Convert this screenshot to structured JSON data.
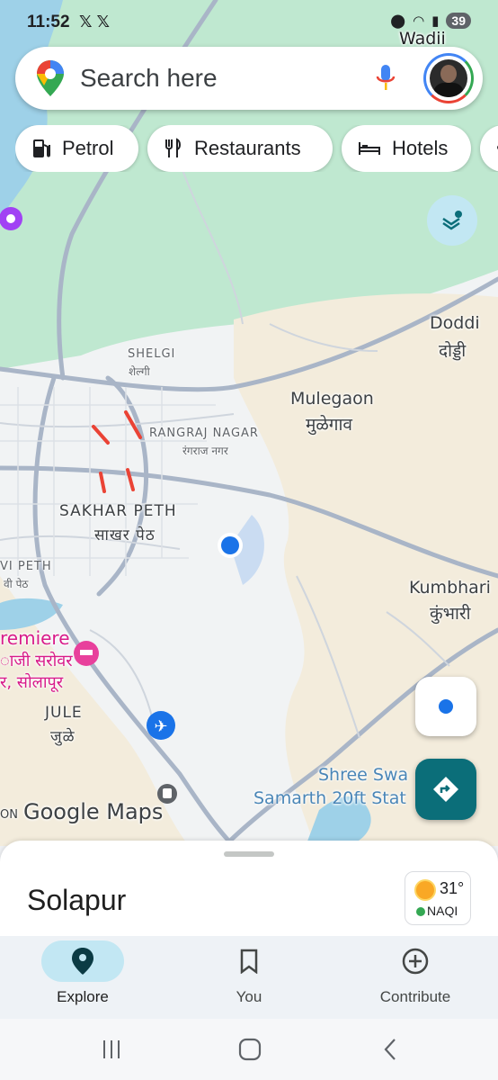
{
  "status_bar": {
    "time": "11:52",
    "notification_icons": "𝕏 𝕏",
    "battery": "39"
  },
  "search": {
    "placeholder": "Search here"
  },
  "chips": [
    {
      "label": "Petrol",
      "icon": "gas-station-icon"
    },
    {
      "label": "Restaurants",
      "icon": "fork-knife-icon"
    },
    {
      "label": "Hotels",
      "icon": "bed-icon"
    }
  ],
  "map_labels": {
    "wadii": "Wadii",
    "doddi_en": "Doddi",
    "doddi_mr": "दोड्डी",
    "shelgi_en": "SHELGI",
    "shelgi_mr": "शेल्गी",
    "mulegaon_en": "Mulegaon",
    "mulegaon_mr": "मुळेगाव",
    "rangraj_en": "RANGRAJ NAGAR",
    "rangraj_mr": "रंगराज नगर",
    "sakhar_en": "SAKHAR PETH",
    "sakhar_mr": "साखर पेठ",
    "vipeth_en": "VI PETH",
    "vipeth_mr": "वी पेठ",
    "kumbhari_en": "Kumbhari",
    "kumbhari_mr": "कुंभारी",
    "premiere": "remiere",
    "sarovar_1": "ाजी सरोवर",
    "sarovar_2": "र, सोलापूर",
    "jule_en": "JULE",
    "jule_mr": "जुळे",
    "shree_1": "Shree Swa",
    "shree_2": "Samarth 20ft Stat",
    "google_prefix": "ON",
    "google_maps": "Google Maps"
  },
  "bottom_sheet": {
    "place": "Solapur",
    "temperature": "31°",
    "aqi_label": "NAQI"
  },
  "bottom_nav": [
    {
      "label": "Explore",
      "icon": "explore-pin-icon",
      "active": true
    },
    {
      "label": "You",
      "icon": "bookmark-icon",
      "active": false
    },
    {
      "label": "Contribute",
      "icon": "add-circle-icon",
      "active": false
    }
  ],
  "colors": {
    "accent": "#0b6e79",
    "location_blue": "#1a73e8",
    "park_green": "#bfe6cf",
    "water_blue": "#9ed1e8",
    "traffic_red": "#ea4335",
    "pill": "#c2e7f3"
  }
}
